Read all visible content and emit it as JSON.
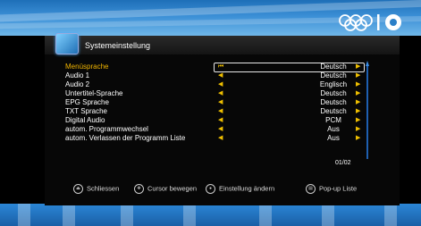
{
  "window": {
    "title": "Systemeinstellung",
    "logo_icon": "olympic-rings-icon"
  },
  "settings": [
    {
      "label": "Menüsprache",
      "value": "Deutsch",
      "selected": true
    },
    {
      "label": "Audio 1",
      "value": "Deutsch"
    },
    {
      "label": "Audio 2",
      "value": "Englisch"
    },
    {
      "label": "Untertitel-Sprache",
      "value": "Deutsch"
    },
    {
      "label": "EPG Sprache",
      "value": "Deutsch"
    },
    {
      "label": "TXT Sprache",
      "value": "Deutsch"
    },
    {
      "label": "Digital Audio",
      "value": "PCM"
    },
    {
      "label": "autom. Programmwechsel",
      "value": "Aus"
    },
    {
      "label": "autom. Verlassen der Programm Liste",
      "value": "Aus"
    }
  ],
  "page_indicator": "01/02",
  "footer": {
    "close": "Schliessen",
    "move": "Cursor bewegen",
    "change": "Einstellung ändern",
    "popup": "Pop-up Liste"
  },
  "colors": {
    "selected_text": "#f0b400",
    "arrow": "#f0c000",
    "panel_bg": "#070707",
    "scroll": "#1e5fb0"
  }
}
